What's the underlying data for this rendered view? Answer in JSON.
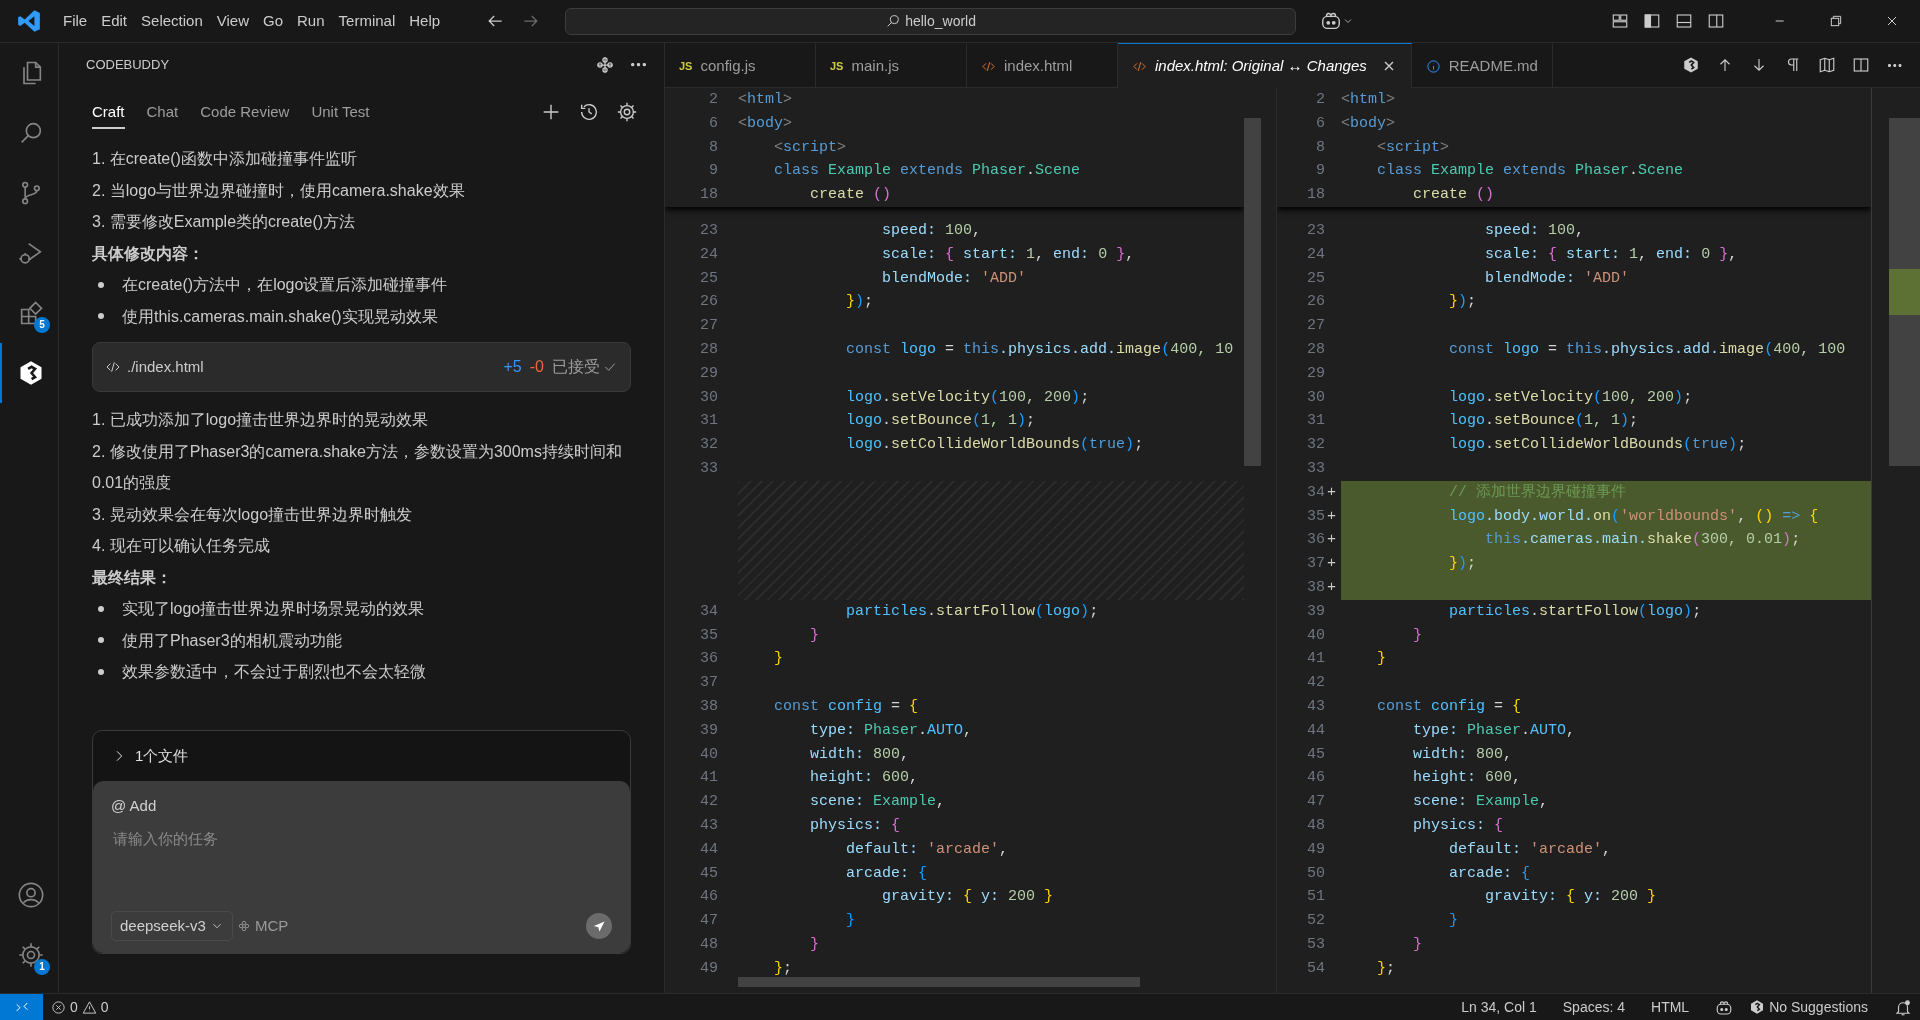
{
  "title_bar": {
    "menu": [
      "File",
      "Edit",
      "Selection",
      "View",
      "Go",
      "Run",
      "Terminal",
      "Help"
    ],
    "command_center": "hello_world"
  },
  "activity_bar": {
    "items": [
      {
        "kind": "files",
        "selected": false
      },
      {
        "kind": "search",
        "selected": false
      },
      {
        "kind": "scm",
        "selected": false
      },
      {
        "kind": "debug",
        "selected": false
      },
      {
        "kind": "extensions",
        "badge": "5",
        "selected": false
      },
      {
        "kind": "codebuddy",
        "selected": true
      }
    ],
    "bottom": [
      {
        "kind": "account"
      },
      {
        "kind": "settings",
        "badge": "1"
      }
    ]
  },
  "panel": {
    "title": "CODEBUDDY",
    "tabs": [
      {
        "label": "Craft",
        "selected": true
      },
      {
        "label": "Chat",
        "selected": false
      },
      {
        "label": "Code Review",
        "selected": false
      },
      {
        "label": "Unit Test",
        "selected": false
      }
    ],
    "messages": [
      {
        "kind": "numbered",
        "text": "1. 在create()函数中添加碰撞事件监听"
      },
      {
        "kind": "numbered",
        "text": "2. 当logo与世界边界碰撞时，使用camera.shake效果"
      },
      {
        "kind": "numbered",
        "text": "3. 需要修改Example类的create()方法"
      },
      {
        "kind": "heading",
        "text": "具体修改内容："
      },
      {
        "kind": "bullet",
        "text": "在create()方法中，在logo设置后添加碰撞事件"
      },
      {
        "kind": "bullet",
        "text": "使用this.cameras.main.shake()实现晃动效果"
      },
      {
        "kind": "file",
        "path": "./index.html",
        "added": "+5",
        "removed": "-0",
        "status": "已接受"
      },
      {
        "kind": "numbered",
        "text": "1. 已成功添加了logo撞击世界边界时的晃动效果"
      },
      {
        "kind": "numbered",
        "text": "2. 修改使用了Phaser3的camera.shake方法，参数设置为300ms持续时间和0.01的强度"
      },
      {
        "kind": "numbered",
        "text": "3. 晃动效果会在每次logo撞击世界边界时触发"
      },
      {
        "kind": "numbered",
        "text": "4. 现在可以确认任务完成"
      },
      {
        "kind": "heading",
        "text": "最终结果："
      },
      {
        "kind": "bullet",
        "text": "实现了logo撞击世界边界时场景晃动的效果"
      },
      {
        "kind": "bullet",
        "text": "使用了Phaser3的相机震动功能"
      },
      {
        "kind": "bullet",
        "text": "效果参数适中，不会过于剧烈也不会太轻微"
      }
    ],
    "files": {
      "label": "1个文件",
      "expanded": false
    },
    "composer": {
      "mention": "@ Add",
      "placeholder": "请输入你的任务",
      "model": "deepseek-v3",
      "tool": "MCP"
    }
  },
  "editor_tabs": [
    {
      "label": "config.js",
      "kind": "js",
      "icon_text": "JS",
      "preview": false,
      "selected": false
    },
    {
      "label": "main.js",
      "kind": "js",
      "icon_text": "JS",
      "preview": false,
      "selected": false
    },
    {
      "label": "index.html",
      "kind": "html",
      "preview": false,
      "selected": false
    },
    {
      "label": "index.html: Original ↔ Changes",
      "kind": "html",
      "preview": true,
      "selected": true
    },
    {
      "label": "README.md",
      "kind": "info",
      "preview": false,
      "selected": false
    }
  ],
  "diff": {
    "original": {
      "sticky": [
        {
          "n": "2",
          "code": [
            {
              "text": "<",
              "kind": "angle"
            },
            {
              "text": "html",
              "kind": "keyword"
            },
            {
              "text": ">",
              "kind": "angle"
            }
          ]
        },
        {
          "n": "6",
          "code": [
            {
              "text": "<",
              "kind": "angle"
            },
            {
              "text": "body",
              "kind": "keyword"
            },
            {
              "text": ">",
              "kind": "angle"
            }
          ]
        },
        {
          "n": "8",
          "code": [
            {
              "text": "    <",
              "kind": "angle"
            },
            {
              "text": "script",
              "kind": "keyword"
            },
            {
              "text": ">",
              "kind": "angle"
            }
          ]
        },
        {
          "n": "9",
          "code": [
            {
              "text": "    class ",
              "kind": "keyword"
            },
            {
              "text": "Example ",
              "kind": "type"
            },
            {
              "text": "extends ",
              "kind": "keyword"
            },
            {
              "text": "Phaser",
              "kind": "type"
            },
            {
              "text": ".",
              "kind": "punct"
            },
            {
              "text": "Scene",
              "kind": "type"
            }
          ]
        },
        {
          "n": "18",
          "code": [
            {
              "text": "        create ",
              "kind": "function"
            },
            {
              "text": "()",
              "kind": "brace2"
            }
          ]
        }
      ],
      "lines": [
        {
          "kind": "normal",
          "n": "23",
          "code": [
            {
              "text": "                speed: ",
              "kind": "property"
            },
            {
              "text": "100",
              "kind": "number"
            },
            {
              "text": ",",
              "kind": "punct"
            }
          ]
        },
        {
          "kind": "normal",
          "n": "24",
          "code": [
            {
              "text": "                scale: ",
              "kind": "property"
            },
            {
              "text": "{ ",
              "kind": "brace2"
            },
            {
              "text": "start: ",
              "kind": "property"
            },
            {
              "text": "1",
              "kind": "number"
            },
            {
              "text": ", ",
              "kind": "punct"
            },
            {
              "text": "end: ",
              "kind": "property"
            },
            {
              "text": "0 ",
              "kind": "number"
            },
            {
              "text": "}",
              "kind": "brace2"
            },
            {
              "text": ",",
              "kind": "punct"
            }
          ]
        },
        {
          "kind": "normal",
          "n": "25",
          "code": [
            {
              "text": "                blendMode: ",
              "kind": "property"
            },
            {
              "text": "'ADD'",
              "kind": "string"
            }
          ]
        },
        {
          "kind": "normal",
          "n": "26",
          "code": [
            {
              "text": "            }",
              "kind": "brace1"
            },
            {
              "text": ")",
              "kind": "brace3"
            },
            {
              "text": ";",
              "kind": "punct"
            }
          ]
        },
        {
          "kind": "normal",
          "n": "27"
        },
        {
          "kind": "normal",
          "n": "28",
          "code": [
            {
              "text": "            const ",
              "kind": "keyword"
            },
            {
              "text": "logo ",
              "kind": "constant"
            },
            {
              "text": "= ",
              "kind": "punct"
            },
            {
              "text": "this",
              "kind": "keyword"
            },
            {
              "text": ".physics.add.",
              "kind": "property"
            },
            {
              "text": "image",
              "kind": "function"
            },
            {
              "text": "(",
              "kind": "brace3"
            },
            {
              "text": "400, 10",
              "kind": "number"
            }
          ]
        },
        {
          "kind": "normal",
          "n": "29"
        },
        {
          "kind": "normal",
          "n": "30",
          "code": [
            {
              "text": "            logo",
              "kind": "constant"
            },
            {
              "text": ".",
              "kind": "punct"
            },
            {
              "text": "setVelocity",
              "kind": "function"
            },
            {
              "text": "(",
              "kind": "brace3"
            },
            {
              "text": "100, 200",
              "kind": "number"
            },
            {
              "text": ")",
              "kind": "brace3"
            },
            {
              "text": ";",
              "kind": "punct"
            }
          ]
        },
        {
          "kind": "normal",
          "n": "31",
          "code": [
            {
              "text": "            logo",
              "kind": "constant"
            },
            {
              "text": ".",
              "kind": "punct"
            },
            {
              "text": "setBounce",
              "kind": "function"
            },
            {
              "text": "(",
              "kind": "brace3"
            },
            {
              "text": "1, 1",
              "kind": "number"
            },
            {
              "text": ")",
              "kind": "brace3"
            },
            {
              "text": ";",
              "kind": "punct"
            }
          ]
        },
        {
          "kind": "normal",
          "n": "32",
          "code": [
            {
              "text": "            logo",
              "kind": "constant"
            },
            {
              "text": ".",
              "kind": "punct"
            },
            {
              "text": "setCollideWorldBounds",
              "kind": "function"
            },
            {
              "text": "(",
              "kind": "brace3"
            },
            {
              "text": "true",
              "kind": "keyword"
            },
            {
              "text": ")",
              "kind": "brace3"
            },
            {
              "text": ";",
              "kind": "punct"
            }
          ]
        },
        {
          "kind": "normal",
          "n": "33"
        },
        {
          "kind": "filler"
        },
        {
          "kind": "filler"
        },
        {
          "kind": "filler"
        },
        {
          "kind": "filler"
        },
        {
          "kind": "filler"
        },
        {
          "kind": "normal",
          "n": "34",
          "code": [
            {
              "text": "            particles",
              "kind": "constant"
            },
            {
              "text": ".",
              "kind": "punct"
            },
            {
              "text": "startFollow",
              "kind": "function"
            },
            {
              "text": "(",
              "kind": "brace3"
            },
            {
              "text": "logo",
              "kind": "constant"
            },
            {
              "text": ")",
              "kind": "brace3"
            },
            {
              "text": ";",
              "kind": "punct"
            }
          ]
        },
        {
          "kind": "normal",
          "n": "35",
          "code": [
            {
              "text": "        }",
              "kind": "brace2"
            }
          ]
        },
        {
          "kind": "normal",
          "n": "36",
          "code": [
            {
              "text": "    }",
              "kind": "brace1"
            }
          ]
        },
        {
          "kind": "normal",
          "n": "37"
        },
        {
          "kind": "normal",
          "n": "38",
          "code": [
            {
              "text": "    const ",
              "kind": "keyword"
            },
            {
              "text": "config ",
              "kind": "constant"
            },
            {
              "text": "= ",
              "kind": "punct"
            },
            {
              "text": "{",
              "kind": "brace1"
            }
          ]
        },
        {
          "kind": "normal",
          "n": "39",
          "code": [
            {
              "text": "        type: ",
              "kind": "property"
            },
            {
              "text": "Phaser",
              "kind": "type"
            },
            {
              "text": ".",
              "kind": "punct"
            },
            {
              "text": "AUTO",
              "kind": "constant"
            },
            {
              "text": ",",
              "kind": "punct"
            }
          ]
        },
        {
          "kind": "normal",
          "n": "40",
          "code": [
            {
              "text": "        width: ",
              "kind": "property"
            },
            {
              "text": "800",
              "kind": "number"
            },
            {
              "text": ",",
              "kind": "punct"
            }
          ]
        },
        {
          "kind": "normal",
          "n": "41",
          "code": [
            {
              "text": "        height: ",
              "kind": "property"
            },
            {
              "text": "600",
              "kind": "number"
            },
            {
              "text": ",",
              "kind": "punct"
            }
          ]
        },
        {
          "kind": "normal",
          "n": "42",
          "code": [
            {
              "text": "        scene: ",
              "kind": "property"
            },
            {
              "text": "Example",
              "kind": "type"
            },
            {
              "text": ",",
              "kind": "punct"
            }
          ]
        },
        {
          "kind": "normal",
          "n": "43",
          "code": [
            {
              "text": "        physics: ",
              "kind": "property"
            },
            {
              "text": "{",
              "kind": "brace2"
            }
          ]
        },
        {
          "kind": "normal",
          "n": "44",
          "code": [
            {
              "text": "            default: ",
              "kind": "property"
            },
            {
              "text": "'arcade'",
              "kind": "string"
            },
            {
              "text": ",",
              "kind": "punct"
            }
          ]
        },
        {
          "kind": "normal",
          "n": "45",
          "code": [
            {
              "text": "            arcade: ",
              "kind": "property"
            },
            {
              "text": "{",
              "kind": "brace3"
            }
          ]
        },
        {
          "kind": "normal",
          "n": "46",
          "code": [
            {
              "text": "                gravity: ",
              "kind": "property"
            },
            {
              "text": "{ ",
              "kind": "brace1"
            },
            {
              "text": "y: ",
              "kind": "property"
            },
            {
              "text": "200 ",
              "kind": "number"
            },
            {
              "text": "}",
              "kind": "brace1"
            }
          ]
        },
        {
          "kind": "normal",
          "n": "47",
          "code": [
            {
              "text": "            }",
              "kind": "brace3"
            }
          ]
        },
        {
          "kind": "normal",
          "n": "48",
          "code": [
            {
              "text": "        }",
              "kind": "brace2"
            }
          ]
        },
        {
          "kind": "normal",
          "n": "49",
          "code": [
            {
              "text": "    }",
              "kind": "brace1"
            },
            {
              "text": ";",
              "kind": "punct"
            }
          ]
        }
      ]
    },
    "modified": {
      "sticky": [
        {
          "n": "2",
          "code": [
            {
              "text": "<",
              "kind": "angle"
            },
            {
              "text": "html",
              "kind": "keyword"
            },
            {
              "text": ">",
              "kind": "angle"
            }
          ]
        },
        {
          "n": "6",
          "code": [
            {
              "text": "<",
              "kind": "angle"
            },
            {
              "text": "body",
              "kind": "keyword"
            },
            {
              "text": ">",
              "kind": "angle"
            }
          ]
        },
        {
          "n": "8",
          "code": [
            {
              "text": "    <",
              "kind": "angle"
            },
            {
              "text": "script",
              "kind": "keyword"
            },
            {
              "text": ">",
              "kind": "angle"
            }
          ]
        },
        {
          "n": "9",
          "code": [
            {
              "text": "    class ",
              "kind": "keyword"
            },
            {
              "text": "Example ",
              "kind": "type"
            },
            {
              "text": "extends ",
              "kind": "keyword"
            },
            {
              "text": "Phaser",
              "kind": "type"
            },
            {
              "text": ".",
              "kind": "punct"
            },
            {
              "text": "Scene",
              "kind": "type"
            }
          ]
        },
        {
          "n": "18",
          "code": [
            {
              "text": "        create ",
              "kind": "function"
            },
            {
              "text": "()",
              "kind": "brace2"
            }
          ]
        }
      ],
      "lines": [
        {
          "kind": "normal",
          "n": "23",
          "code": [
            {
              "text": "                speed: ",
              "kind": "property"
            },
            {
              "text": "100",
              "kind": "number"
            },
            {
              "text": ",",
              "kind": "punct"
            }
          ]
        },
        {
          "kind": "normal",
          "n": "24",
          "code": [
            {
              "text": "                scale: ",
              "kind": "property"
            },
            {
              "text": "{ ",
              "kind": "brace2"
            },
            {
              "text": "start: ",
              "kind": "property"
            },
            {
              "text": "1",
              "kind": "number"
            },
            {
              "text": ", ",
              "kind": "punct"
            },
            {
              "text": "end: ",
              "kind": "property"
            },
            {
              "text": "0 ",
              "kind": "number"
            },
            {
              "text": "}",
              "kind": "brace2"
            },
            {
              "text": ",",
              "kind": "punct"
            }
          ]
        },
        {
          "kind": "normal",
          "n": "25",
          "code": [
            {
              "text": "                blendMode: ",
              "kind": "property"
            },
            {
              "text": "'ADD'",
              "kind": "string"
            }
          ]
        },
        {
          "kind": "normal",
          "n": "26",
          "code": [
            {
              "text": "            }",
              "kind": "brace1"
            },
            {
              "text": ")",
              "kind": "brace3"
            },
            {
              "text": ";",
              "kind": "punct"
            }
          ]
        },
        {
          "kind": "normal",
          "n": "27"
        },
        {
          "kind": "normal",
          "n": "28",
          "code": [
            {
              "text": "            const ",
              "kind": "keyword"
            },
            {
              "text": "logo ",
              "kind": "constant"
            },
            {
              "text": "= ",
              "kind": "punct"
            },
            {
              "text": "this",
              "kind": "keyword"
            },
            {
              "text": ".physics.add.",
              "kind": "property"
            },
            {
              "text": "image",
              "kind": "function"
            },
            {
              "text": "(",
              "kind": "brace3"
            },
            {
              "text": "400, 100",
              "kind": "number"
            }
          ]
        },
        {
          "kind": "normal",
          "n": "29"
        },
        {
          "kind": "normal",
          "n": "30",
          "code": [
            {
              "text": "            logo",
              "kind": "constant"
            },
            {
              "text": ".",
              "kind": "punct"
            },
            {
              "text": "setVelocity",
              "kind": "function"
            },
            {
              "text": "(",
              "kind": "brace3"
            },
            {
              "text": "100, 200",
              "kind": "number"
            },
            {
              "text": ")",
              "kind": "brace3"
            },
            {
              "text": ";",
              "kind": "punct"
            }
          ]
        },
        {
          "kind": "normal",
          "n": "31",
          "code": [
            {
              "text": "            logo",
              "kind": "constant"
            },
            {
              "text": ".",
              "kind": "punct"
            },
            {
              "text": "setBounce",
              "kind": "function"
            },
            {
              "text": "(",
              "kind": "brace3"
            },
            {
              "text": "1, 1",
              "kind": "number"
            },
            {
              "text": ")",
              "kind": "brace3"
            },
            {
              "text": ";",
              "kind": "punct"
            }
          ]
        },
        {
          "kind": "normal",
          "n": "32",
          "code": [
            {
              "text": "            logo",
              "kind": "constant"
            },
            {
              "text": ".",
              "kind": "punct"
            },
            {
              "text": "setCollideWorldBounds",
              "kind": "function"
            },
            {
              "text": "(",
              "kind": "brace3"
            },
            {
              "text": "true",
              "kind": "keyword"
            },
            {
              "text": ")",
              "kind": "brace3"
            },
            {
              "text": ";",
              "kind": "punct"
            }
          ]
        },
        {
          "kind": "normal",
          "n": "33"
        },
        {
          "kind": "added",
          "n": "34",
          "marker": "+",
          "code": [
            {
              "text": "            // 添加世界边界碰撞事件",
              "kind": "comment"
            }
          ]
        },
        {
          "kind": "added",
          "n": "35",
          "marker": "+",
          "code": [
            {
              "text": "            logo",
              "kind": "constant"
            },
            {
              "text": ".body.world.",
              "kind": "property"
            },
            {
              "text": "on",
              "kind": "function"
            },
            {
              "text": "(",
              "kind": "brace3"
            },
            {
              "text": "'worldbounds'",
              "kind": "string"
            },
            {
              "text": ", ",
              "kind": "punct"
            },
            {
              "text": "() ",
              "kind": "brace1"
            },
            {
              "text": "=> ",
              "kind": "keyword"
            },
            {
              "text": "{",
              "kind": "brace1"
            }
          ]
        },
        {
          "kind": "added",
          "n": "36",
          "marker": "+",
          "code": [
            {
              "text": "                this",
              "kind": "keyword"
            },
            {
              "text": ".cameras.main.",
              "kind": "property"
            },
            {
              "text": "shake",
              "kind": "function"
            },
            {
              "text": "(",
              "kind": "brace2"
            },
            {
              "text": "300, 0.01",
              "kind": "number"
            },
            {
              "text": ")",
              "kind": "brace2"
            },
            {
              "text": ";",
              "kind": "punct"
            }
          ]
        },
        {
          "kind": "added",
          "n": "37",
          "marker": "+",
          "code": [
            {
              "text": "            }",
              "kind": "brace1"
            },
            {
              "text": ")",
              "kind": "brace3"
            },
            {
              "text": ";",
              "kind": "punct"
            }
          ]
        },
        {
          "kind": "added",
          "n": "38",
          "marker": "+"
        },
        {
          "kind": "normal",
          "n": "39",
          "code": [
            {
              "text": "            particles",
              "kind": "constant"
            },
            {
              "text": ".",
              "kind": "punct"
            },
            {
              "text": "startFollow",
              "kind": "function"
            },
            {
              "text": "(",
              "kind": "brace3"
            },
            {
              "text": "logo",
              "kind": "constant"
            },
            {
              "text": ")",
              "kind": "brace3"
            },
            {
              "text": ";",
              "kind": "punct"
            }
          ]
        },
        {
          "kind": "normal",
          "n": "40",
          "code": [
            {
              "text": "        }",
              "kind": "brace2"
            }
          ]
        },
        {
          "kind": "normal",
          "n": "41",
          "code": [
            {
              "text": "    }",
              "kind": "brace1"
            }
          ]
        },
        {
          "kind": "normal",
          "n": "42"
        },
        {
          "kind": "normal",
          "n": "43",
          "code": [
            {
              "text": "    const ",
              "kind": "keyword"
            },
            {
              "text": "config ",
              "kind": "constant"
            },
            {
              "text": "= ",
              "kind": "punct"
            },
            {
              "text": "{",
              "kind": "brace1"
            }
          ]
        },
        {
          "kind": "normal",
          "n": "44",
          "code": [
            {
              "text": "        type: ",
              "kind": "property"
            },
            {
              "text": "Phaser",
              "kind": "type"
            },
            {
              "text": ".",
              "kind": "punct"
            },
            {
              "text": "AUTO",
              "kind": "constant"
            },
            {
              "text": ",",
              "kind": "punct"
            }
          ]
        },
        {
          "kind": "normal",
          "n": "45",
          "code": [
            {
              "text": "        width: ",
              "kind": "property"
            },
            {
              "text": "800",
              "kind": "number"
            },
            {
              "text": ",",
              "kind": "punct"
            }
          ]
        },
        {
          "kind": "normal",
          "n": "46",
          "code": [
            {
              "text": "        height: ",
              "kind": "property"
            },
            {
              "text": "600",
              "kind": "number"
            },
            {
              "text": ",",
              "kind": "punct"
            }
          ]
        },
        {
          "kind": "normal",
          "n": "47",
          "code": [
            {
              "text": "        scene: ",
              "kind": "property"
            },
            {
              "text": "Example",
              "kind": "type"
            },
            {
              "text": ",",
              "kind": "punct"
            }
          ]
        },
        {
          "kind": "normal",
          "n": "48",
          "code": [
            {
              "text": "        physics: ",
              "kind": "property"
            },
            {
              "text": "{",
              "kind": "brace2"
            }
          ]
        },
        {
          "kind": "normal",
          "n": "49",
          "code": [
            {
              "text": "            default: ",
              "kind": "property"
            },
            {
              "text": "'arcade'",
              "kind": "string"
            },
            {
              "text": ",",
              "kind": "punct"
            }
          ]
        },
        {
          "kind": "normal",
          "n": "50",
          "code": [
            {
              "text": "            arcade: ",
              "kind": "property"
            },
            {
              "text": "{",
              "kind": "brace3"
            }
          ]
        },
        {
          "kind": "normal",
          "n": "51",
          "code": [
            {
              "text": "                gravity: ",
              "kind": "property"
            },
            {
              "text": "{ ",
              "kind": "brace1"
            },
            {
              "text": "y: ",
              "kind": "property"
            },
            {
              "text": "200 ",
              "kind": "number"
            },
            {
              "text": "}",
              "kind": "brace1"
            }
          ]
        },
        {
          "kind": "normal",
          "n": "52",
          "code": [
            {
              "text": "            }",
              "kind": "brace3"
            }
          ]
        },
        {
          "kind": "normal",
          "n": "53",
          "code": [
            {
              "text": "        }",
              "kind": "brace2"
            }
          ]
        },
        {
          "kind": "normal",
          "n": "54",
          "code": [
            {
              "text": "    }",
              "kind": "brace1"
            },
            {
              "text": ";",
              "kind": "punct"
            }
          ]
        }
      ]
    }
  },
  "status_bar": {
    "errors": "0",
    "warnings": "0",
    "items": [
      "Ln 34, Col 1",
      "Spaces: 4",
      "HTML"
    ],
    "suggestions": "No Suggestions"
  }
}
